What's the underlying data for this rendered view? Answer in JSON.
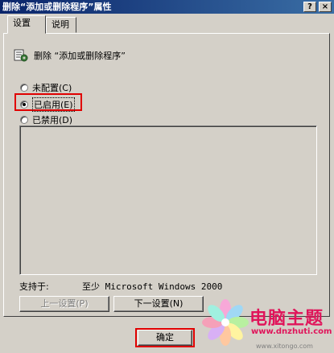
{
  "window": {
    "title": "删除“添加或删除程序”属性",
    "help_button": "?",
    "close_button": "×"
  },
  "tabs": [
    {
      "label": "设置",
      "active": true
    },
    {
      "label": "说明",
      "active": false
    }
  ],
  "policy": {
    "icon": "policy-setting-icon",
    "name": "删除 “添加或删除程序”"
  },
  "options": [
    {
      "label": "未配置",
      "hotkey": "C",
      "checked": false
    },
    {
      "label": "已启用",
      "hotkey": "E",
      "checked": true
    },
    {
      "label": "已禁用",
      "hotkey": "D",
      "checked": false
    }
  ],
  "supported": {
    "label": "支持于:",
    "value": "至少 Microsoft Windows 2000"
  },
  "buttons": {
    "prev": "上一设置",
    "prev_hotkey": "P",
    "next": "下一设置",
    "next_hotkey": "N",
    "ok": "确定"
  },
  "watermark": {
    "brand": "电脑主题",
    "url": "www.dnzhuti.com",
    "small": "www.xitongo.com"
  },
  "colors": {
    "highlight": "#e00000",
    "title_start": "#0a246a",
    "title_end": "#3a6ea5",
    "dialog_face": "#d4d0c8",
    "watermark": "#e0145a"
  }
}
